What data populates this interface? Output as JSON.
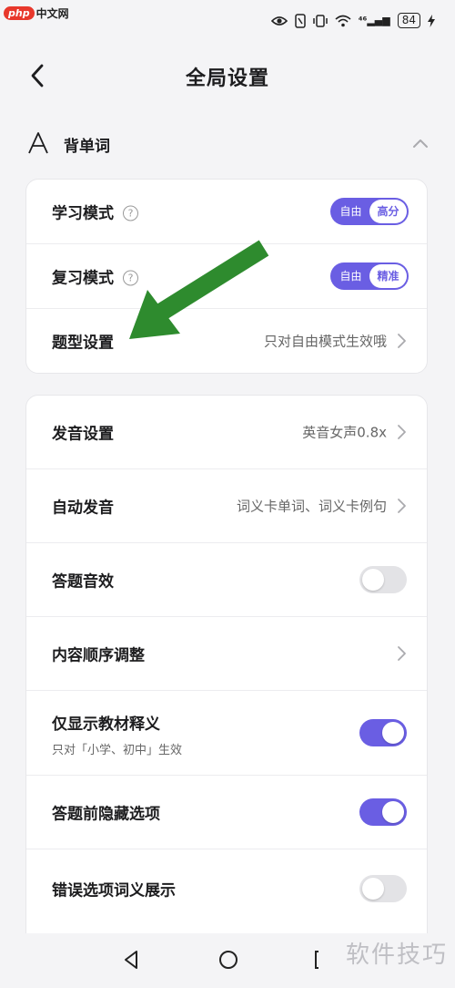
{
  "status_bar": {
    "watermark_logo": "php",
    "watermark_site": "中文网",
    "signal_label": "⁴⁶",
    "battery": "84"
  },
  "header": {
    "title": "全局设置"
  },
  "section": {
    "title": "背单词"
  },
  "card1": {
    "rows": [
      {
        "label": "学习模式",
        "help": "?",
        "options": [
          "自由",
          "高分"
        ],
        "selected": "高分"
      },
      {
        "label": "复习模式",
        "help": "?",
        "options": [
          "自由",
          "精准"
        ],
        "selected": "精准"
      },
      {
        "label": "题型设置",
        "value": "只对自由模式生效哦"
      }
    ]
  },
  "card2": {
    "rows": [
      {
        "label": "发音设置",
        "value": "英音女声0.8x"
      },
      {
        "label": "自动发音",
        "value": "词义卡单词、词义卡例句"
      },
      {
        "label": "答题音效",
        "toggle": false
      },
      {
        "label": "内容顺序调整"
      },
      {
        "label": "仅显示教材释义",
        "sub": "只对「小学、初中」生效",
        "toggle": true
      },
      {
        "label": "答题前隐藏选项",
        "toggle": true
      },
      {
        "label": "错误选项词义展示",
        "toggle": false
      }
    ]
  },
  "colors": {
    "accent": "#6a5ee3",
    "toggle_off": "#e3e3e6",
    "annotation_arrow": "#2e8b2e"
  },
  "footer": {
    "watermark": "软件技巧"
  }
}
